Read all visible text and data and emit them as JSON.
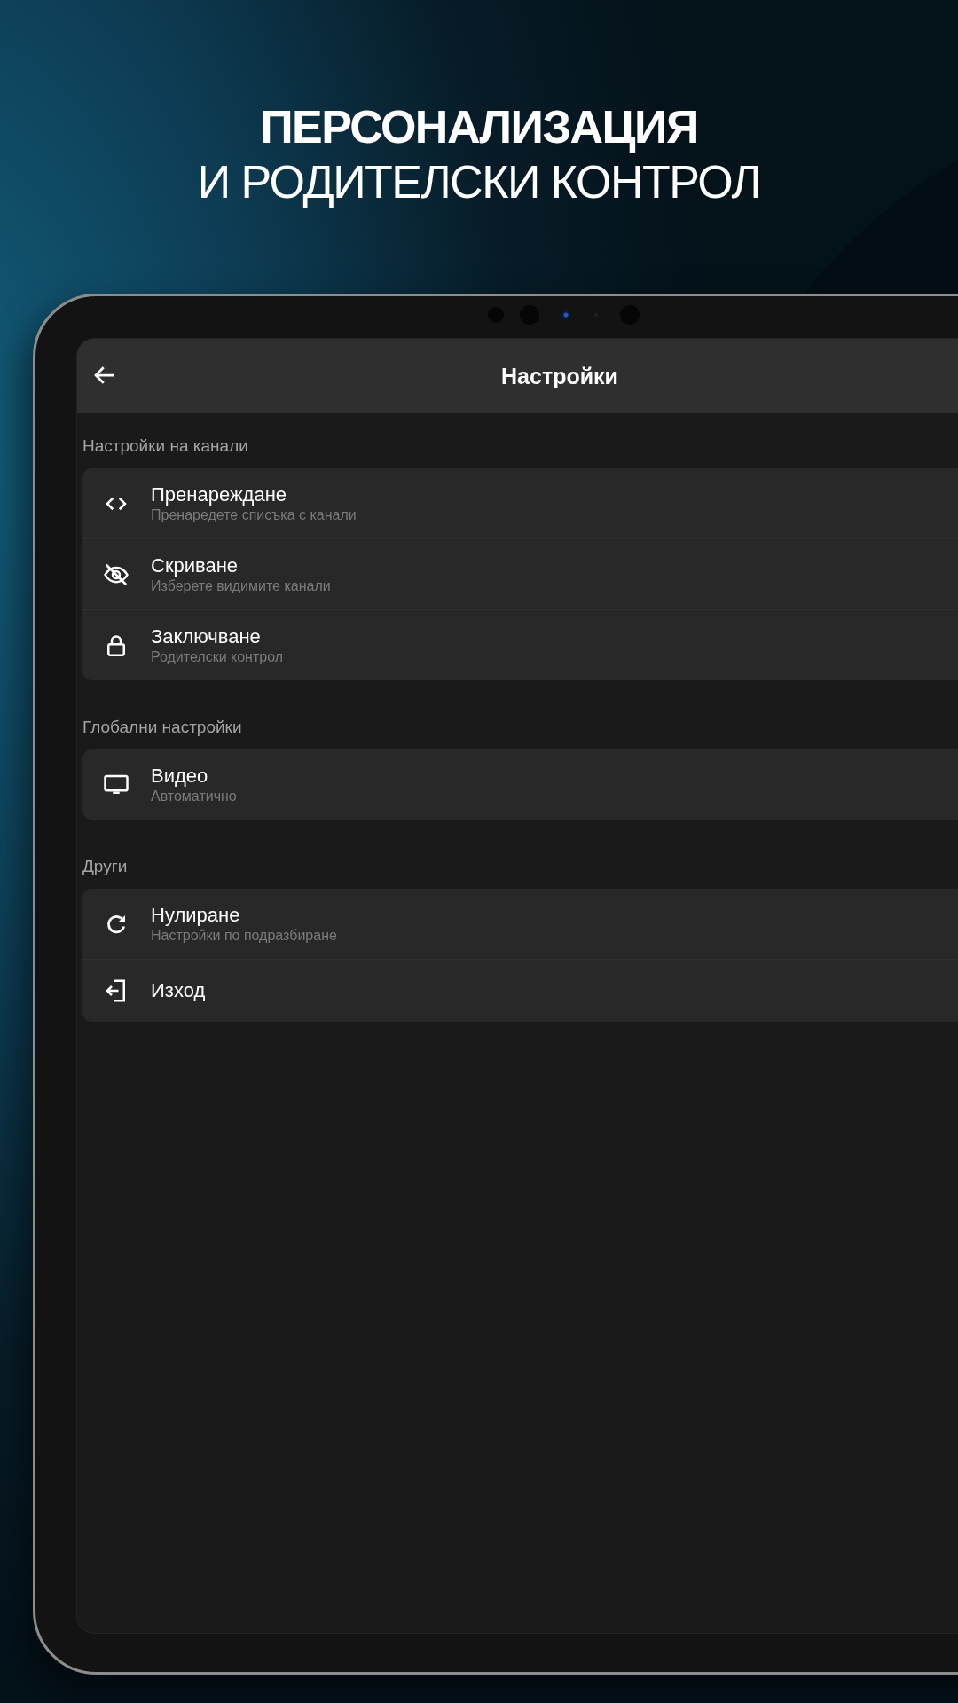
{
  "headline": {
    "title": "ПЕРСОНАЛИЗАЦИЯ",
    "subtitle": "И РОДИТЕЛСКИ КОНТРОЛ"
  },
  "app_bar": {
    "title": "Настройки"
  },
  "sections": [
    {
      "label": "Настройки на канали",
      "items": [
        {
          "kind": "reorder",
          "title": "Пренареждане",
          "subtitle": "Пренаредете списъка с канали"
        },
        {
          "kind": "hide",
          "title": "Скриване",
          "subtitle": "Изберете видимите канали"
        },
        {
          "kind": "lock",
          "title": "Заключване",
          "subtitle": "Родителски контрол"
        }
      ]
    },
    {
      "label": "Глобални настройки",
      "items": [
        {
          "kind": "video",
          "title": "Видео",
          "subtitle": "Автоматично"
        }
      ]
    },
    {
      "label": "Други",
      "items": [
        {
          "kind": "reset",
          "title": "Нулиране",
          "subtitle": "Настройки по подразбиране"
        },
        {
          "kind": "exit",
          "title": "Изход"
        }
      ]
    }
  ]
}
